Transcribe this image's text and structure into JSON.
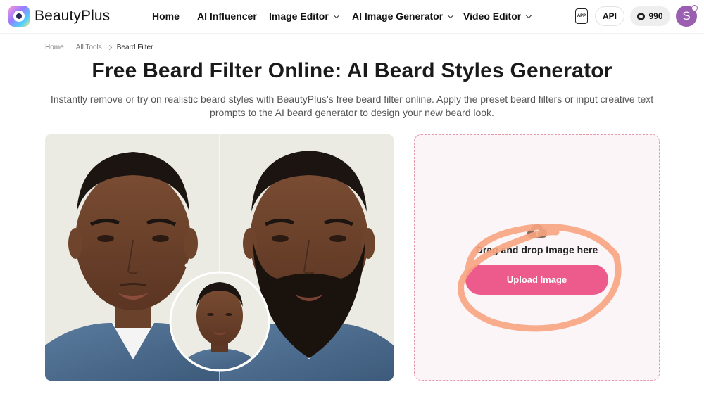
{
  "header": {
    "brand": "BeautyPlus",
    "nav": [
      {
        "label": "Home",
        "has_dropdown": false
      },
      {
        "label": "AI Influencer",
        "has_dropdown": false
      },
      {
        "label": "Image Editor",
        "has_dropdown": true
      },
      {
        "label": "AI Image Generator",
        "has_dropdown": true
      },
      {
        "label": "Video Editor",
        "has_dropdown": true
      }
    ],
    "app_icon_label": "APP",
    "api_label": "API",
    "credits": "990",
    "avatar_initial": "S"
  },
  "breadcrumb": {
    "items": [
      "Home",
      "All Tools",
      "Beard Filter"
    ]
  },
  "page": {
    "title": "Free Beard Filter Online: AI Beard Styles Generator",
    "subtitle": "Instantly remove or try on realistic beard styles with BeautyPlus's free beard filter online. Apply the preset beard filters or input creative text prompts to the AI beard generator to design your new beard look."
  },
  "upload": {
    "drag_text": "Drag and drop Image here",
    "button_label": "Upload Image"
  },
  "colors": {
    "accent": "#ec5b8c",
    "panel_border": "#e59aac",
    "panel_bg": "#fcf5f7",
    "avatar": "#9a5fb0",
    "highlight": "#f7a47f"
  }
}
